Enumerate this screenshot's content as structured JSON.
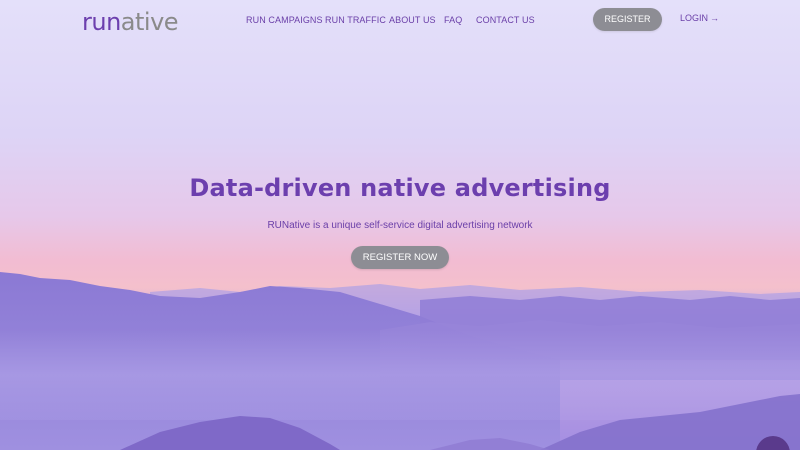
{
  "logo": {
    "part1": "run",
    "part2": "ative"
  },
  "nav": {
    "items": [
      {
        "label": "RUN CAMPAIGNS"
      },
      {
        "label": "RUN TRAFFIC"
      },
      {
        "label": "ABOUT US"
      },
      {
        "label": "FAQ"
      },
      {
        "label": "CONTACT US"
      }
    ],
    "register_label": "REGISTER",
    "login_label": "LOGIN",
    "login_arrow": "→"
  },
  "hero": {
    "title": "Data-driven native advertising",
    "subtitle": "RUNative is a unique self-service digital advertising network",
    "cta_label": "REGISTER NOW"
  },
  "colors": {
    "brand_purple": "#6c3fae",
    "button_gray": "#8d8d94",
    "logo_gray": "#8a8a8a"
  },
  "icons": {
    "login_arrow": "arrow-right-icon",
    "chat": "chat-bubble-icon"
  }
}
